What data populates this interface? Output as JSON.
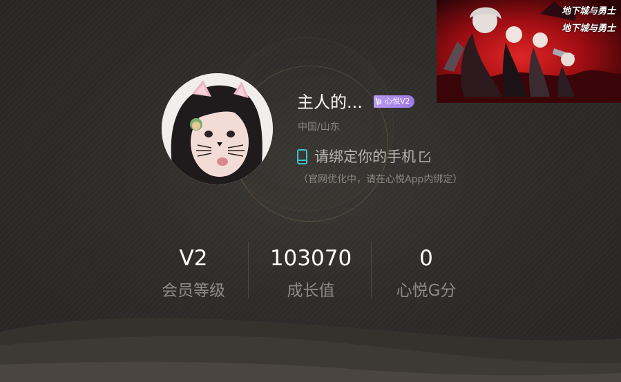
{
  "profile": {
    "username": "主人的...",
    "vip_badge": "心悦V2",
    "location": "中国/山东",
    "phone_prompt": "请绑定你的手机",
    "phone_note": "（官网优化中，请在心悦App内绑定）",
    "avatar_icon": "user-avatar-photo"
  },
  "stats": [
    {
      "value": "V2",
      "label": "会员等级"
    },
    {
      "value": "103070",
      "label": "成长值"
    },
    {
      "value": "0",
      "label": "心悦G分"
    }
  ],
  "ad": {
    "logo_line1": "地下城与勇士",
    "logo_line2": "地下城与勇士"
  },
  "colors": {
    "background": "#2b2a29",
    "badge": "#a98aec",
    "phone_icon": "#38c3c9",
    "ring": "#c8aa6e",
    "muted_text": "#8e8a86"
  }
}
